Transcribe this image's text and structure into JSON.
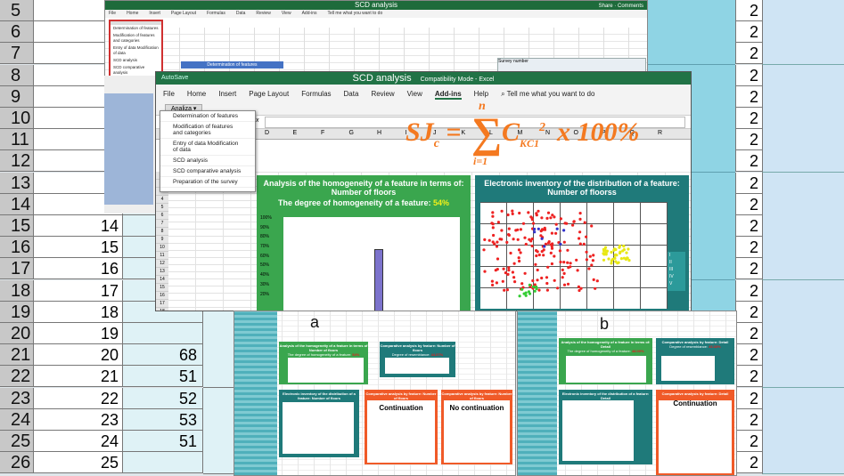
{
  "background_sheet": {
    "rows": [
      {
        "row": "5",
        "a": "",
        "b": "",
        "r": "2"
      },
      {
        "row": "6",
        "a": "",
        "b": "",
        "r": "2"
      },
      {
        "row": "7",
        "a": "",
        "b": "",
        "r": "2"
      },
      {
        "row": "8",
        "a": "",
        "b": "",
        "r": "2"
      },
      {
        "row": "9",
        "a": "",
        "b": "",
        "r": "2"
      },
      {
        "row": "10",
        "a": "",
        "b": "",
        "r": "2"
      },
      {
        "row": "11",
        "a": "",
        "b": "",
        "r": "2"
      },
      {
        "row": "12",
        "a": "",
        "b": "",
        "r": "2"
      },
      {
        "row": "13",
        "a": "",
        "b": "",
        "r": "2"
      },
      {
        "row": "14",
        "a": "",
        "b": "",
        "r": "2"
      },
      {
        "row": "15",
        "a": "14",
        "b": "",
        "r": "2"
      },
      {
        "row": "16",
        "a": "15",
        "b": "",
        "r": "2"
      },
      {
        "row": "17",
        "a": "16",
        "b": "",
        "r": "2"
      },
      {
        "row": "18",
        "a": "17",
        "b": "",
        "r": "2"
      },
      {
        "row": "19",
        "a": "18",
        "b": "",
        "r": "2"
      },
      {
        "row": "20",
        "a": "19",
        "b": "",
        "r": "2"
      },
      {
        "row": "21",
        "a": "20",
        "b": "68",
        "r": "2"
      },
      {
        "row": "22",
        "a": "21",
        "b": "51",
        "r": "2"
      },
      {
        "row": "23",
        "a": "22",
        "b": "52",
        "r": "2"
      },
      {
        "row": "24",
        "a": "23",
        "b": "53",
        "r": "2"
      },
      {
        "row": "25",
        "a": "24",
        "b": "51",
        "r": "2"
      },
      {
        "row": "26",
        "a": "25",
        "b": "",
        "r": "2"
      }
    ]
  },
  "top_window": {
    "title": "SCD analysis",
    "share": "Share",
    "comments": "Comments",
    "menu": [
      "File",
      "Home",
      "Insert",
      "Page Layout",
      "Formulas",
      "Data",
      "Review",
      "View",
      "Add-ins",
      "Tell me what you want to do"
    ],
    "banner": "Determination of features",
    "sheet_label": "Survey number",
    "dropdown": [
      "Determination of features",
      "Modification of features and categories",
      "Entry of data Modification of data",
      "SCD analysis",
      "SCD comparative analysis",
      "Preparation of the survey"
    ]
  },
  "main_window": {
    "autosave": "AutoSave",
    "title": "SCD analysis",
    "mode": "Compatibility Mode - Excel",
    "tabs": [
      "File",
      "Home",
      "Insert",
      "Page Layout",
      "Formulas",
      "Data",
      "Review",
      "View",
      "Add-ins",
      "Help"
    ],
    "active_tab": "Add-ins",
    "tell_me": "Tell me what you want to do",
    "analiza": "Analiza",
    "fx": "fx",
    "columns": [
      "D",
      "E",
      "F",
      "G",
      "H",
      "I",
      "J",
      "K",
      "L",
      "M",
      "N",
      "O",
      "P",
      "Q",
      "R"
    ],
    "row_numbers": [
      "1",
      "2",
      "3",
      "4",
      "5",
      "6",
      "7",
      "8",
      "9",
      "10",
      "11",
      "12",
      "13",
      "14",
      "15",
      "16",
      "17",
      "18",
      "19",
      "20"
    ],
    "dropdown": [
      "Determination of features",
      "Modification of features and categories",
      "Entry of data Modification of data",
      "SCD analysis",
      "SCD comparative analysis",
      "Preparation of the survey"
    ],
    "formula": {
      "lhs": "SJ",
      "lhs_sub": "c",
      "eq": "=",
      "upper": "n",
      "lower": "i=1",
      "term": "C",
      "term_sub": "KC1",
      "power": "2",
      "tail": "x 100%"
    },
    "left_panel": {
      "title": "Analysis of the homogeneity of a feature in terms of: Number of floors",
      "degree_label": "The degree of homogeneity of a feature:",
      "degree_value": "54%",
      "y_ticks": [
        "100%",
        "90%",
        "80%",
        "70%",
        "60%",
        "50%",
        "40%",
        "30%",
        "20%"
      ],
      "color": "#3aa64e"
    },
    "right_panel": {
      "title": "Electronic inventory of the distribution of a feature: Number of floorss",
      "legend": [
        "I",
        "II",
        "III",
        "IV",
        "V"
      ],
      "color": "#1f7a7a"
    }
  },
  "bottom_a": {
    "label": "a",
    "p1_title": "Analysis of the homogeneity of a feature in terms of Number of floors",
    "p1_degree": "The degree of homogeneity of a feature:",
    "p1_value": "54%",
    "p2_title": "Comparative analysis by feature: Number of floors",
    "p2_degree": "Degree of resemblance:",
    "p2_value": "44.07%",
    "p3_title": "Electronic inventory of the distribution of a feature: Number of floors",
    "p4_title": "Comparative analysis by feature: Number of floors",
    "p4_big": "Continuation",
    "p5_title": "Comparative analysis by feature: Number of floors",
    "p5_big": "No continuation"
  },
  "bottom_b": {
    "label": "b",
    "p1_title": "Analysis of the homogeneity of a feature in terms of: Detail",
    "p1_degree": "The degree of homogeneity of a feature:",
    "p1_value": "48.00%",
    "p2_title": "Comparative analysis by feature: Detail",
    "p2_degree": "Degree of resemblance:",
    "p2_value": "33.33%",
    "p3_title": "Electronic inventory of the distribution of a feature: Detail",
    "p4_title": "Comparative analysis by feature: Detail",
    "p4_big": "Continuation"
  }
}
